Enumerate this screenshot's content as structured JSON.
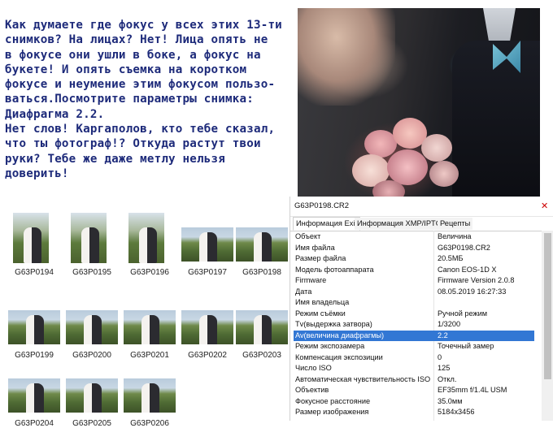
{
  "headline": {
    "lines": [
      "Как думаете где фокус у всех этих 13-ти",
      "снимков? На лицах? Нет! Лица опять не",
      "в фокусе они ушли в боке, а фокус на",
      "букете! И опять съемка на коротком",
      "фокусе и неумение этим фокусом пользо-",
      "ваться.Посмотрите параметры снимка:",
      "Диафрагма 2.2.",
      "Нет слов! Каргаполов, кто тебе сказал,",
      "что ты фотограф!? Откуда растут твои",
      "руки? Тебе же даже метлу нельзя",
      "доверить!"
    ]
  },
  "thumbnails": [
    {
      "name": "G63P0194",
      "orientation": "portrait"
    },
    {
      "name": "G63P0195",
      "orientation": "portrait"
    },
    {
      "name": "G63P0196",
      "orientation": "portrait"
    },
    {
      "name": "G63P0197",
      "orientation": "landscape"
    },
    {
      "name": "G63P0198",
      "orientation": "landscape"
    },
    {
      "name": "G63P0199",
      "orientation": "landscape"
    },
    {
      "name": "G63P0200",
      "orientation": "landscape"
    },
    {
      "name": "G63P0201",
      "orientation": "landscape"
    },
    {
      "name": "G63P0202",
      "orientation": "landscape"
    },
    {
      "name": "G63P0203",
      "orientation": "landscape"
    },
    {
      "name": "G63P0204",
      "orientation": "landscape"
    },
    {
      "name": "G63P0205",
      "orientation": "landscape"
    },
    {
      "name": "G63P0206",
      "orientation": "landscape"
    }
  ],
  "exif": {
    "title": "G63P0198.CR2",
    "close_icon": "✕",
    "tabs": [
      "Информация Exif",
      "Информация XMP/IPTC",
      "Рецепты"
    ],
    "active_tab": 0,
    "selected_row": 9,
    "selection_color": "#3277d4",
    "rows": [
      {
        "key": "Объект",
        "value": "Величина"
      },
      {
        "key": "Имя файла",
        "value": "G63P0198.CR2"
      },
      {
        "key": "Размер файла",
        "value": "20.5МБ"
      },
      {
        "key": "Модель фотоаппарата",
        "value": "Canon EOS-1D X"
      },
      {
        "key": "Firmware",
        "value": "Firmware Version 2.0.8"
      },
      {
        "key": "Дата",
        "value": "08.05.2019 16:27:33"
      },
      {
        "key": "Имя владельца",
        "value": ""
      },
      {
        "key": "Режим съёмки",
        "value": "Ручной режим"
      },
      {
        "key": "Tv(выдержка затвора)",
        "value": "1/3200"
      },
      {
        "key": "Av(величина диафрагмы)",
        "value": "2.2"
      },
      {
        "key": "Режим экспозамера",
        "value": "Точечный замер"
      },
      {
        "key": "Компенсация экспозиции",
        "value": "0"
      },
      {
        "key": "Число ISO",
        "value": "125"
      },
      {
        "key": "Автоматическая чувствительность ISO",
        "value": "Откл."
      },
      {
        "key": "Объектив",
        "value": "EF35mm f/1.4L USM"
      },
      {
        "key": "Фокусное расстояние",
        "value": "35.0мм"
      },
      {
        "key": "Размер изображения",
        "value": "5184x3456"
      }
    ]
  }
}
